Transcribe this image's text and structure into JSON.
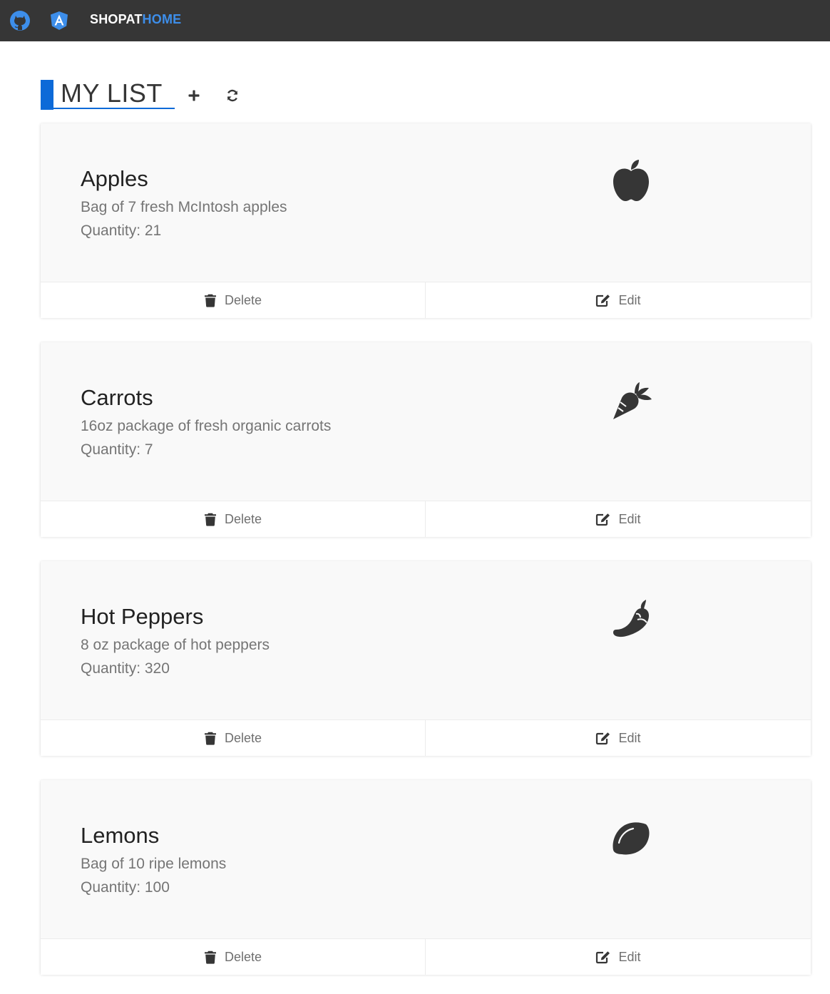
{
  "navbar": {
    "brand_part1": "SHOPAT",
    "brand_part2": "HOME",
    "icons": [
      "github-icon",
      "angular-icon"
    ]
  },
  "list": {
    "title": "MY LIST",
    "add_icon": "plus-icon",
    "refresh_icon": "refresh-icon"
  },
  "items": [
    {
      "name": "Apples",
      "description": "Bag of 7 fresh McIntosh apples",
      "quantity": "Quantity: 21",
      "icon": "apple-icon"
    },
    {
      "name": "Carrots",
      "description": "16oz package of fresh organic carrots",
      "quantity": "Quantity: 7",
      "icon": "carrot-icon"
    },
    {
      "name": "Hot Peppers",
      "description": "8 oz package of hot peppers",
      "quantity": "Quantity: 320",
      "icon": "pepper-icon"
    },
    {
      "name": "Lemons",
      "description": "Bag of 10 ripe lemons",
      "quantity": "Quantity: 100",
      "icon": "lemon-icon"
    }
  ],
  "actions": {
    "delete_label": "Delete",
    "edit_label": "Edit"
  },
  "colors": {
    "navbar": "#363636",
    "accent": "#0d6ad8",
    "brand_highlight": "#3d8eea",
    "icon": "#363636"
  }
}
